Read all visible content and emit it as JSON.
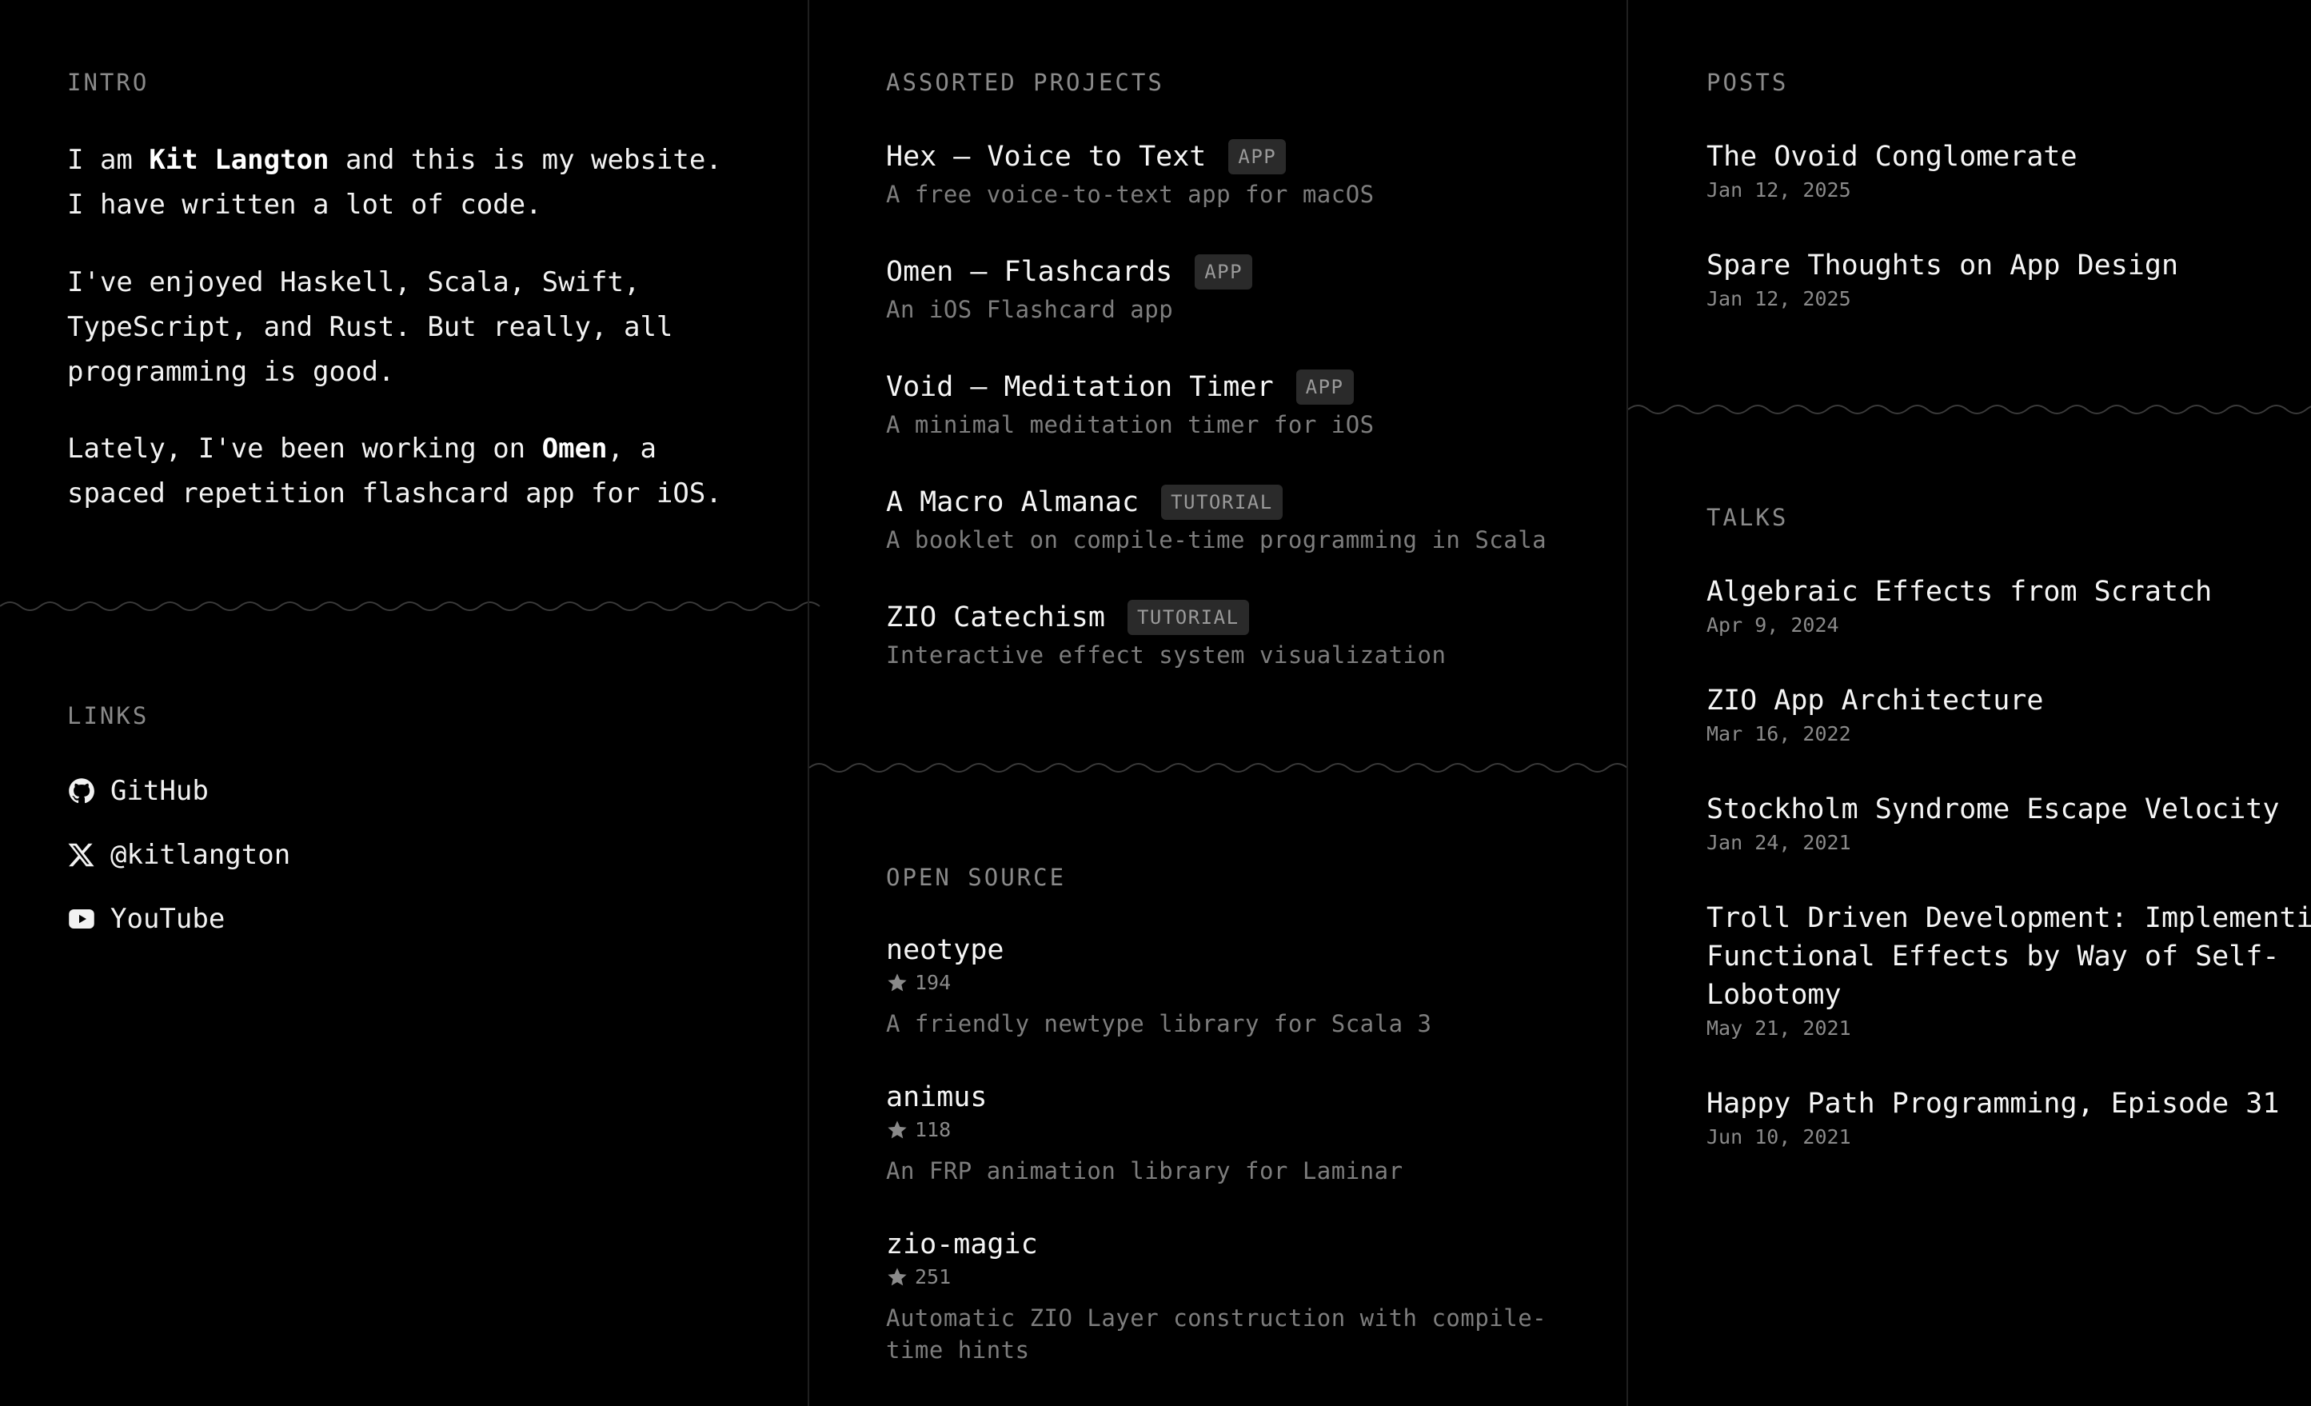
{
  "intro": {
    "title": "INTRO",
    "p1_pre": "I am ",
    "name": "Kit Langton",
    "p1_post": " and this is my website.",
    "p1_line2": "I have written a lot of code.",
    "p2_line1": "I've enjoyed Haskell, Scala, Swift,",
    "p2_line2": "TypeScript, and Rust. But really, all",
    "p2_line3": "programming is good.",
    "p3_pre": "Lately, I've been working on ",
    "p3_bold": "Omen",
    "p3_post": ", a",
    "p3_line2": "spaced repetition flashcard app for iOS."
  },
  "links": {
    "title": "LINKS",
    "items": [
      {
        "label": "GitHub",
        "icon": "github-icon"
      },
      {
        "label": "@kitlangton",
        "icon": "x-icon"
      },
      {
        "label": "YouTube",
        "icon": "youtube-icon"
      }
    ]
  },
  "projects": {
    "title": "ASSORTED PROJECTS",
    "items": [
      {
        "title": "Hex — Voice to Text",
        "badge": "APP",
        "desc": "A free voice-to-text app for macOS"
      },
      {
        "title": "Omen — Flashcards",
        "badge": "APP",
        "desc": "An iOS Flashcard app"
      },
      {
        "title": "Void — Meditation Timer",
        "badge": "APP",
        "desc": "A minimal meditation timer for iOS"
      },
      {
        "title": "A Macro Almanac",
        "badge": "TUTORIAL",
        "desc": "A booklet on compile-time programming in Scala"
      },
      {
        "title": "ZIO Catechism",
        "badge": "TUTORIAL",
        "desc": "Interactive effect system visualization"
      }
    ]
  },
  "open_source": {
    "title": "OPEN SOURCE",
    "items": [
      {
        "name": "neotype",
        "stars": "194",
        "desc": "A friendly newtype library for Scala 3"
      },
      {
        "name": "animus",
        "stars": "118",
        "desc": "An FRP animation library for Laminar"
      },
      {
        "name": "zio-magic",
        "stars": "251",
        "desc_line1": "Automatic ZIO Layer construction with compile-",
        "desc_line2": "time hints"
      }
    ]
  },
  "posts": {
    "title": "POSTS",
    "items": [
      {
        "title": "The Ovoid Conglomerate",
        "date": "Jan 12, 2025"
      },
      {
        "title": "Spare Thoughts on App Design",
        "date": "Jan 12, 2025"
      }
    ]
  },
  "talks": {
    "title": "TALKS",
    "items": [
      {
        "title": "Algebraic Effects from Scratch",
        "date": "Apr 9, 2024"
      },
      {
        "title": "ZIO App Architecture",
        "date": "Mar 16, 2022"
      },
      {
        "title": "Stockholm Syndrome Escape Velocity",
        "date": "Jan 24, 2021"
      },
      {
        "title_line1": "Troll Driven Development: Implementing",
        "title_line2": "Functional Effects by Way of Self-",
        "title_line3": "Lobotomy",
        "date": "May 21, 2021"
      },
      {
        "title": "Happy Path Programming, Episode 31",
        "date": "Jun 10, 2021"
      }
    ]
  },
  "colors": {
    "background": "#000000",
    "text": "#f2f2f2",
    "muted": "#7d7d7d",
    "badge_bg": "#2a2a2a",
    "divider": "#3a3a3a"
  }
}
